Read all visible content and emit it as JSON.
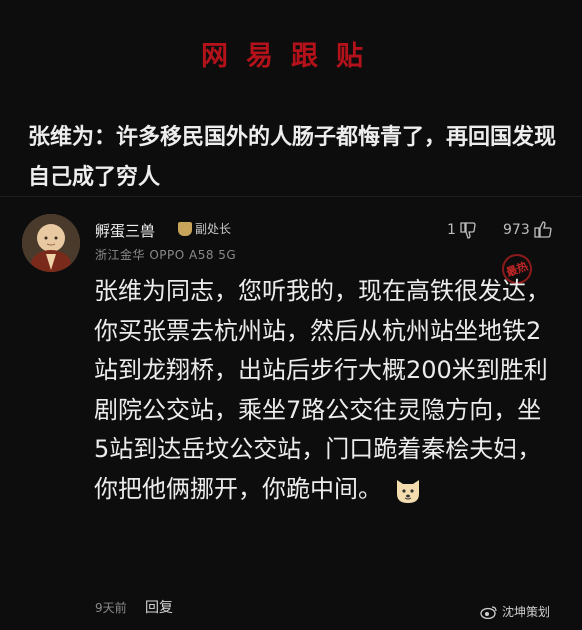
{
  "header": {
    "title": "网易跟贴"
  },
  "headline": {
    "text": "张维为：许多移民国外的人肠子都悔青了，再回国发现自己成了穷人"
  },
  "comment": {
    "username": "孵蛋三兽",
    "badge_label": "副处长",
    "meta": "浙江金华  OPPO A58 5G",
    "dislike_count": "1",
    "like_count": "973",
    "hot_label": "最热",
    "body": "张维为同志，您听我的，现在高铁很发达，你买张票去杭州站，然后从杭州站坐地铁2站到龙翔桥，出站后步行大概200米到胜利剧院公交站，乘坐7路公交往灵隐方向，坐5站到达岳坟公交站，门口跪着秦桧夫妇，你把他俩挪开，你跪中间。",
    "time": "9天前",
    "reply_label": "回复"
  },
  "watermark": {
    "text": "沈坤策划"
  },
  "icons": {
    "avatar": "monk-avatar",
    "badge": "badge-icon",
    "dislike": "thumbs-down-icon",
    "like": "thumbs-up-icon",
    "emoji": "dog-face-emoji-icon",
    "weibo": "weibo-logo-icon"
  },
  "colors": {
    "title_red": "#b3121b",
    "background": "#0d0d0d",
    "badge_gold": "#c8a35a"
  }
}
